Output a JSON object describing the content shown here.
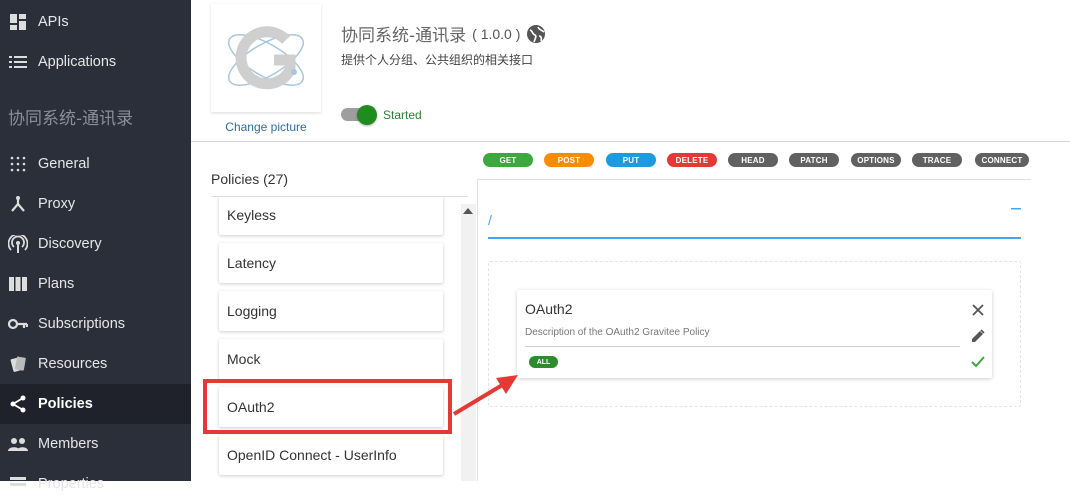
{
  "sidebar": {
    "items_top": [
      {
        "label": "APIs",
        "icon": "dashboard-icon"
      },
      {
        "label": "Applications",
        "icon": "list-icon"
      }
    ],
    "section_title": "协同系统-通讯录",
    "items": [
      {
        "label": "General",
        "icon": "dots-grid-icon"
      },
      {
        "label": "Proxy",
        "icon": "fork-icon"
      },
      {
        "label": "Discovery",
        "icon": "broadcast-icon"
      },
      {
        "label": "Plans",
        "icon": "columns-icon"
      },
      {
        "label": "Subscriptions",
        "icon": "key-icon"
      },
      {
        "label": "Resources",
        "icon": "cards-icon"
      },
      {
        "label": "Policies",
        "icon": "share-icon",
        "active": true
      },
      {
        "label": "Members",
        "icon": "people-icon"
      },
      {
        "label": "Properties",
        "icon": "properties-icon"
      }
    ]
  },
  "header": {
    "change_picture": "Change picture",
    "api_name": "协同系统-通讯录",
    "version": "( 1.0.0 )",
    "description": "提供个人分组、公共组织的相关接口",
    "status": "Started",
    "status_on": true
  },
  "policies": {
    "title": "Policies (27)",
    "items": [
      "Keyless",
      "Latency",
      "Logging",
      "Mock",
      "OAuth2",
      "OpenID Connect - UserInfo"
    ],
    "highlighted": "OAuth2"
  },
  "methods": [
    {
      "label": "GET",
      "color": "#3da83d"
    },
    {
      "label": "POST",
      "color": "#fb8c00"
    },
    {
      "label": "PUT",
      "color": "#1e9be0"
    },
    {
      "label": "DELETE",
      "color": "#e53935"
    },
    {
      "label": "HEAD",
      "color": "#616161"
    },
    {
      "label": "PATCH",
      "color": "#616161"
    },
    {
      "label": "OPTIONS",
      "color": "#616161"
    },
    {
      "label": "TRACE",
      "color": "#616161"
    },
    {
      "label": "CONNECT",
      "color": "#616161"
    }
  ],
  "path": {
    "value": "/"
  },
  "policy_card": {
    "title": "OAuth2",
    "description": "Description of the OAuth2 Gravitee Policy",
    "scope": "ALL"
  },
  "colors": {
    "accent": "#42a5f5",
    "sidebar_bg": "#2b2f3a",
    "highlight": "#e53935"
  }
}
